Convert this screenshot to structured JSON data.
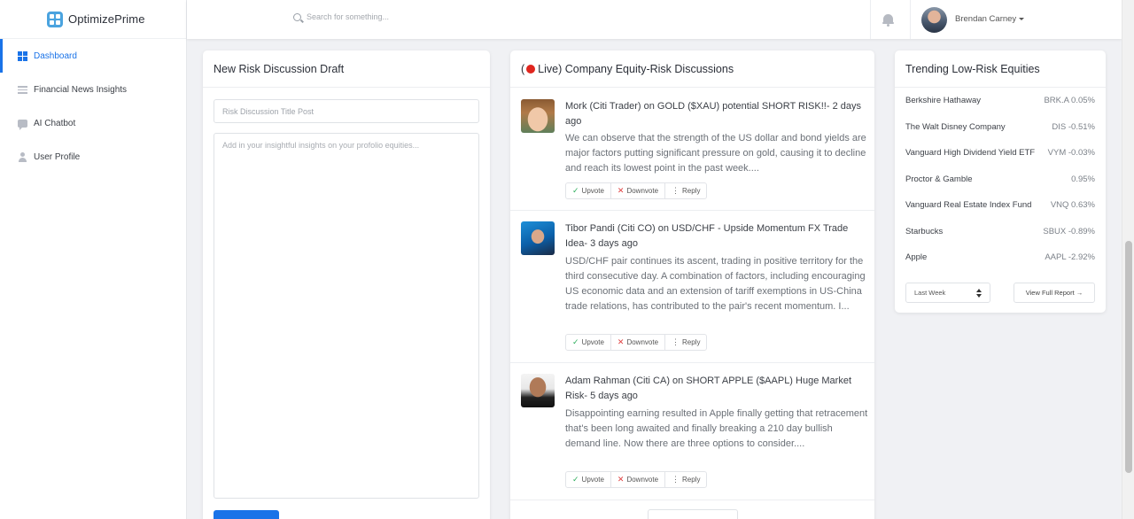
{
  "app": {
    "name": "OptimizePrime"
  },
  "sidebar": {
    "items": [
      {
        "label": "Dashboard",
        "icon": "dashboard-icon",
        "active": true
      },
      {
        "label": "Financial News Insights",
        "icon": "news-icon"
      },
      {
        "label": "AI Chatbot",
        "icon": "chat-icon"
      },
      {
        "label": "User Profile",
        "icon": "user-icon"
      }
    ]
  },
  "topbar": {
    "search_placeholder": "Search for something...",
    "user_name": "Brendan Carney"
  },
  "draft": {
    "header": "New Risk Discussion Draft",
    "title_placeholder": "Risk Discussion Title Post",
    "body_placeholder": "Add in your insightful insights on your profolio equities...",
    "submit_label": ""
  },
  "discussions": {
    "header_prefix": "(",
    "header_text": " Live) Company Equity-Risk Discussions",
    "posts": [
      {
        "title": "Mork (Citi Trader) on GOLD ($XAU) potential SHORT RISK!!- 2 days ago",
        "body": "We can observe that the strength of the US dollar and bond yields are major factors putting significant pressure on gold, causing it to decline and reach its lowest point in the past week....",
        "upvote": "Upvote",
        "downvote": "Downvote",
        "reply": "Reply"
      },
      {
        "title": "Tibor Pandi (Citi CO) on USD/CHF - Upside Momentum FX Trade Idea- 3 days ago",
        "body": "USD/CHF pair continues its ascent, trading in positive territory for the third consecutive day. A combination of factors, including encouraging US economic data and an extension of tariff exemptions in US-China trade relations, has contributed to the pair's recent momentum. I...",
        "upvote": "Upvote",
        "downvote": "Downvote",
        "reply": "Reply"
      },
      {
        "title": "Adam Rahman (Citi CA) on SHORT APPLE ($AAPL) Huge Market Risk- 5 days ago",
        "body": "Disappointing earning resulted in Apple finally getting that retracement that's been long awaited and finally breaking a 210 day bullish demand line. Now there are three options to consider....",
        "upvote": "Upvote",
        "downvote": "Downvote",
        "reply": "Reply"
      }
    ]
  },
  "trending": {
    "header": "Trending Low-Risk Equities",
    "rows": [
      {
        "name": "Berkshire Hathaway",
        "value": "BRK.A 0.05%"
      },
      {
        "name": "The Walt Disney Company",
        "value": "DIS -0.51%"
      },
      {
        "name": "Vanguard High Dividend Yield ETF",
        "value": "VYM -0.03%"
      },
      {
        "name": "Proctor & Gamble",
        "value": "0.95%"
      },
      {
        "name": "Vanguard Real Estate Index Fund",
        "value": "VNQ 0.63%"
      },
      {
        "name": "Starbucks",
        "value": "SBUX -0.89%"
      },
      {
        "name": "Apple",
        "value": "AAPL -2.92%"
      }
    ],
    "period_select": "Last Week",
    "report_button": "View Full Report →"
  },
  "colors": {
    "accent": "#1a73e8",
    "live": "#e0261e",
    "upvote": "#2eae5c",
    "downvote": "#e04040"
  }
}
